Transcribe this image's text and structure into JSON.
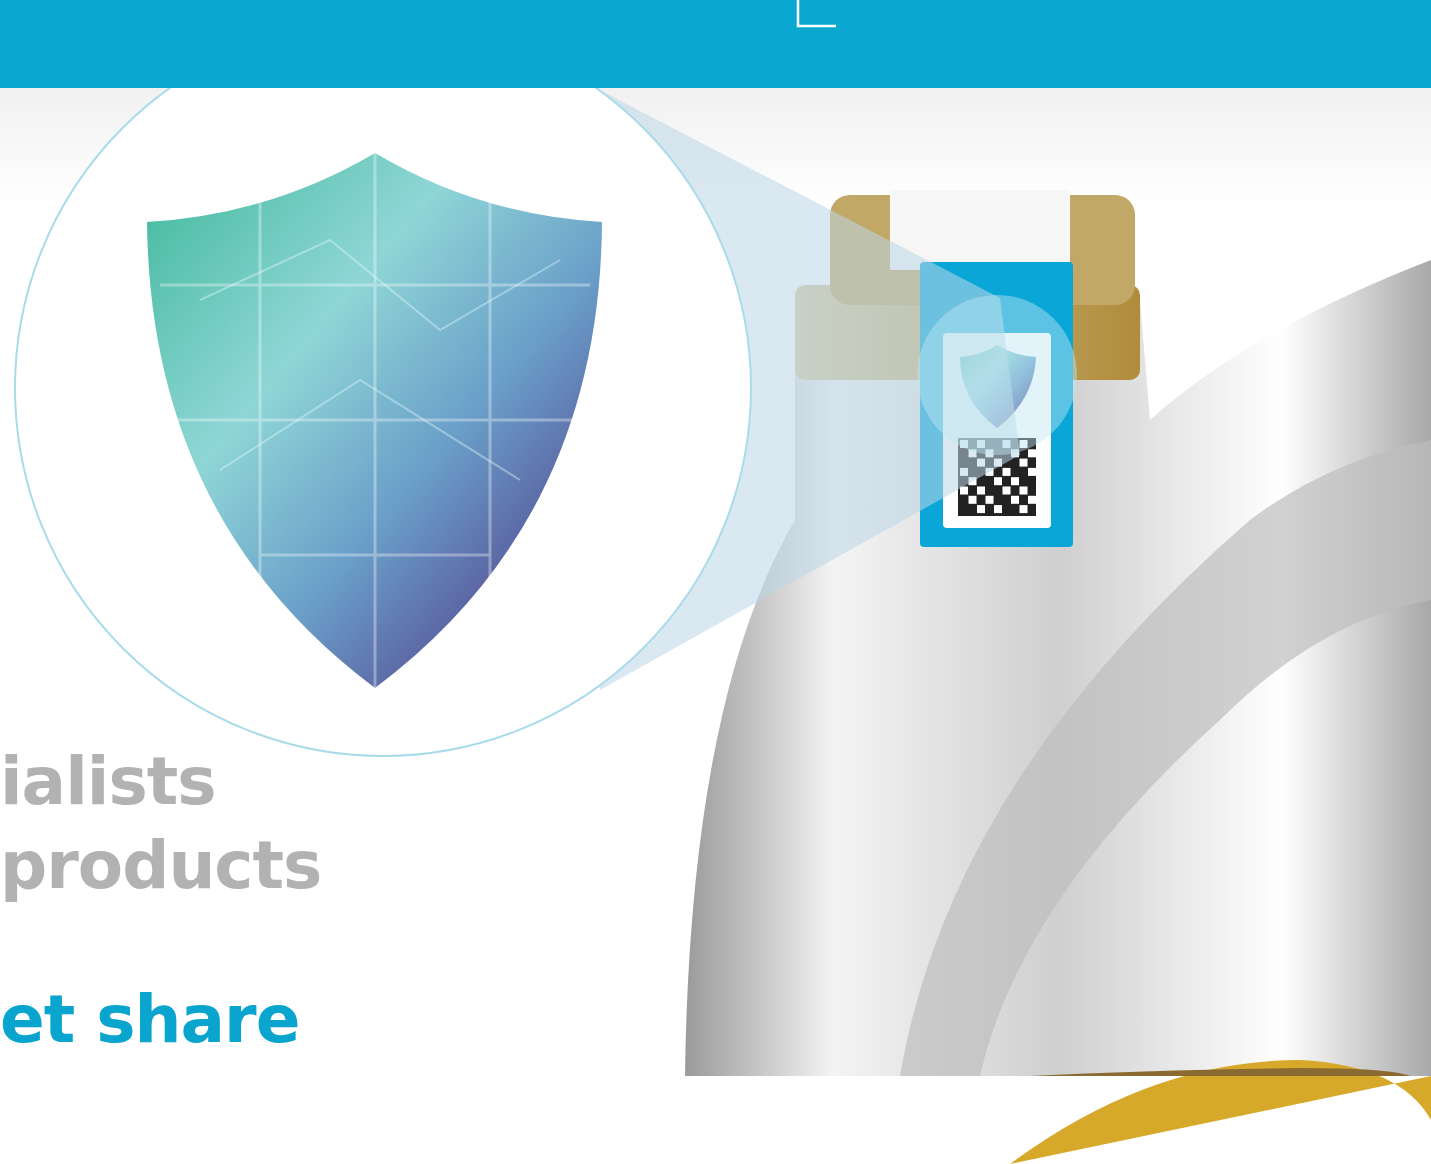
{
  "headline_lines": [
    "ialists",
    "products"
  ],
  "tagline": "et share"
}
